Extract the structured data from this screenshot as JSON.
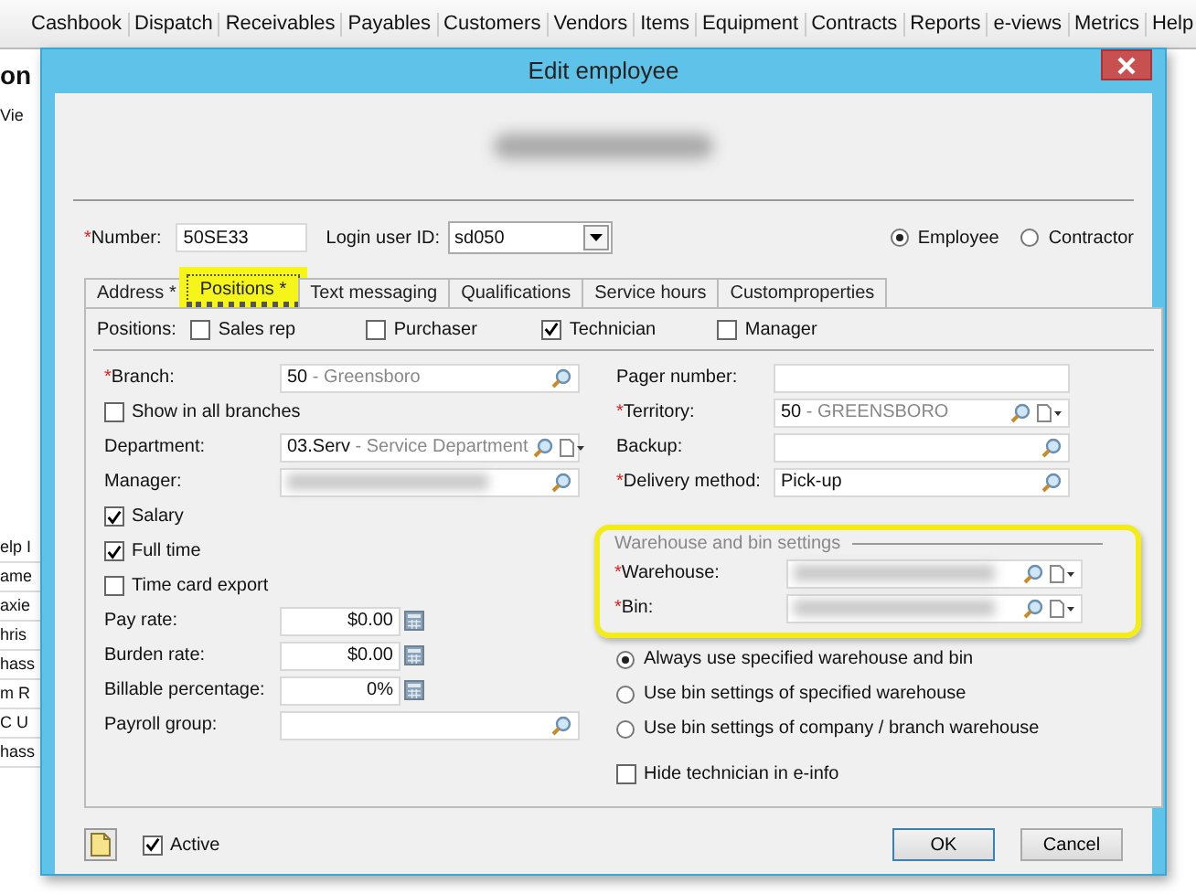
{
  "menu": {
    "items": [
      "Cashbook",
      "Dispatch",
      "Receivables",
      "Payables",
      "Customers",
      "Vendors",
      "Items",
      "Equipment",
      "Contracts",
      "Reports",
      "e-views",
      "Metrics",
      "Help"
    ]
  },
  "background": {
    "heading": "on",
    "toolbar_label": "Vie",
    "list": [
      "elp I",
      "ame",
      "axie",
      "hris",
      "hass",
      "m R",
      "C U",
      "hass"
    ]
  },
  "dialog": {
    "title": "Edit employee",
    "number": {
      "mark": "*",
      "label": "Number:",
      "value": "50SE33"
    },
    "login": {
      "label": "Login user ID:",
      "value": "sd050"
    },
    "type": [
      {
        "label": "Employee",
        "selected": true
      },
      {
        "label": "Contractor",
        "selected": false
      }
    ],
    "tabs": [
      {
        "label": "Address *",
        "selected": false,
        "highlighted": false
      },
      {
        "label": "Positions *",
        "selected": true,
        "highlighted": true
      },
      {
        "label": "Text messaging",
        "selected": false,
        "highlighted": false
      },
      {
        "label": "Qualifications",
        "selected": false,
        "highlighted": false
      },
      {
        "label": "Service hours",
        "selected": false,
        "highlighted": false
      },
      {
        "label": "Customproperties",
        "selected": false,
        "highlighted": false
      }
    ],
    "positions": {
      "label": "Positions:",
      "options": [
        {
          "label": "Sales rep",
          "checked": false
        },
        {
          "label": "Purchaser",
          "checked": false
        },
        {
          "label": "Technician",
          "checked": true
        },
        {
          "label": "Manager",
          "checked": false
        }
      ]
    },
    "left_fields": [
      {
        "kind": "field",
        "mark": "*",
        "label": "Branch:",
        "value": "50",
        "detail": "- Greensboro",
        "lookup": true
      },
      {
        "kind": "checkbox",
        "label": "Show in all branches",
        "checked": false
      },
      {
        "kind": "field",
        "label": "Department:",
        "value": "03.Serv",
        "detail": "- Service Department",
        "lookup": true,
        "menu": true
      },
      {
        "kind": "field",
        "label": "Manager:",
        "blurred": true,
        "lookup": true
      },
      {
        "kind": "checkbox",
        "label": "Salary",
        "checked": true
      },
      {
        "kind": "checkbox",
        "label": "Full time",
        "checked": true
      },
      {
        "kind": "checkbox",
        "label": "Time card export",
        "checked": false
      },
      {
        "kind": "amount",
        "label": "Pay rate:",
        "value": "$0.00"
      },
      {
        "kind": "amount",
        "label": "Burden rate:",
        "value": "$0.00"
      },
      {
        "kind": "percent",
        "label": "Billable percentage:",
        "value": "0%"
      },
      {
        "kind": "field",
        "label": "Payroll group:",
        "lookup": true
      }
    ],
    "right_fields": [
      {
        "kind": "field",
        "label": "Pager number:"
      },
      {
        "kind": "field",
        "mark": "*",
        "label": "Territory:",
        "value": "50",
        "detail": "- GREENSBORO",
        "lookup": true,
        "menu": true
      },
      {
        "kind": "field",
        "label": "Backup:",
        "lookup": true
      },
      {
        "kind": "field",
        "mark": "*",
        "label": "Delivery method:",
        "value": "Pick-up",
        "lookup": true
      }
    ],
    "warehouse": {
      "title": "Warehouse and bin settings",
      "highlighted": true,
      "fields": [
        {
          "kind": "field",
          "mark": "*",
          "label": "Warehouse:",
          "blurred": true,
          "lookup": true,
          "menu": true
        },
        {
          "kind": "field",
          "mark": "*",
          "label": "Bin:",
          "blurred": true,
          "lookup": true,
          "menu": true
        }
      ]
    },
    "bin_options": [
      {
        "label": "Always use specified warehouse and bin",
        "selected": true
      },
      {
        "label": "Use bin settings of specified warehouse",
        "selected": false
      },
      {
        "label": "Use bin settings of company / branch warehouse",
        "selected": false
      }
    ],
    "hide": {
      "label": "Hide technician in e-info",
      "checked": false
    },
    "active": {
      "label": "Active",
      "checked": true
    },
    "buttons": [
      "OK",
      "Cancel"
    ]
  }
}
